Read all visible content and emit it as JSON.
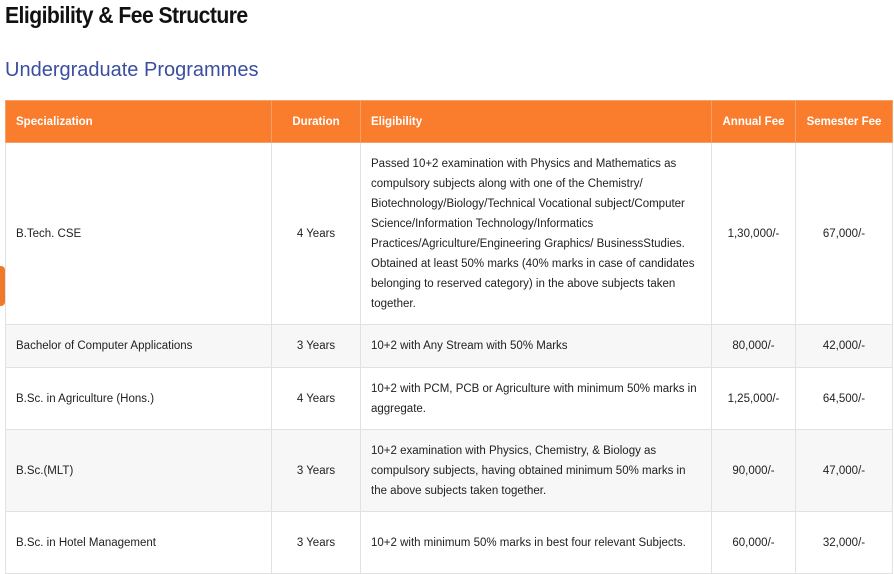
{
  "page": {
    "title": "Eligibility & Fee Structure",
    "section_title": "Undergraduate Programmes"
  },
  "table": {
    "headers": [
      "Specialization",
      "Duration",
      "Eligibility",
      "Annual Fee",
      "Semester Fee"
    ],
    "rows": [
      {
        "specialization": "B.Tech. CSE",
        "duration": "4 Years",
        "eligibility": "Passed 10+2 examination with Physics and Mathematics as compulsory subjects along with one of the Chemistry/ Biotechnology/Biology/Technical Vocational subject/Computer Science/Information Technology/Informatics Practices/Agriculture/Engineering Graphics/ BusinessStudies. Obtained at least 50% marks (40% marks in case of candidates belonging to reserved category) in the above subjects taken together.",
        "annual_fee": "1,30,000/-",
        "semester_fee": "67,000/-"
      },
      {
        "specialization": "Bachelor of Computer Applications",
        "duration": "3 Years",
        "eligibility": "10+2 with Any Stream with 50% Marks",
        "annual_fee": "80,000/-",
        "semester_fee": "42,000/-"
      },
      {
        "specialization": "B.Sc. in Agriculture (Hons.)",
        "duration": "4 Years",
        "eligibility": "10+2 with PCM, PCB or Agriculture with minimum 50% marks in aggregate.",
        "annual_fee": "1,25,000/-",
        "semester_fee": "64,500/-"
      },
      {
        "specialization": "B.Sc.(MLT)",
        "duration": "3 Years",
        "eligibility": "10+2 examination with Physics, Chemistry, & Biology as compulsory subjects, having obtained minimum 50% marks in the above subjects taken together.",
        "annual_fee": "90,000/-",
        "semester_fee": "47,000/-"
      },
      {
        "specialization": "B.Sc. in Hotel Management",
        "duration": "3 Years",
        "eligibility": "10+2 with minimum 50% marks in best four relevant Subjects.",
        "annual_fee": "60,000/-",
        "semester_fee": "32,000/-"
      }
    ]
  },
  "colors": {
    "header_bg": "#f97d2d",
    "section_title": "#3b4ea0",
    "edge_tab": "#f07a2a"
  }
}
